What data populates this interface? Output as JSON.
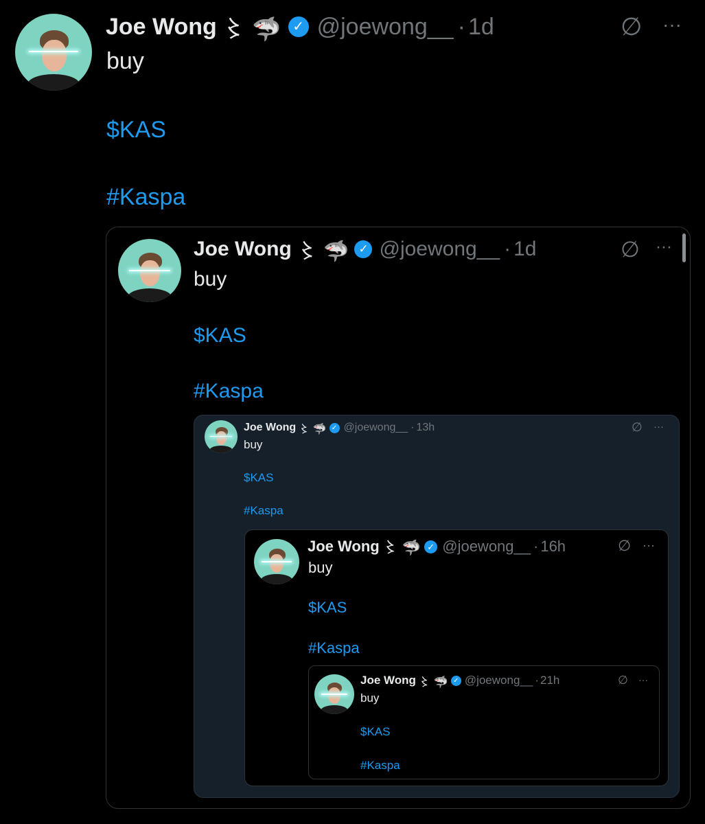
{
  "tweets": [
    {
      "name": "Joe Wong",
      "symbols": "〻 🦈",
      "handle": "@joewong__",
      "dot": "·",
      "time": "1d",
      "body": "buy",
      "ticker": "$KAS",
      "hashtag": "#Kaspa"
    },
    {
      "name": "Joe Wong",
      "symbols": "〻 🦈",
      "handle": "@joewong__",
      "dot": "·",
      "time": "1d",
      "body": "buy",
      "ticker": "$KAS",
      "hashtag": "#Kaspa"
    },
    {
      "name": "Joe Wong",
      "symbols": "〻 🦈",
      "handle": "@joewong__",
      "dot": "·",
      "time": "13h",
      "body": "buy",
      "ticker": "$KAS",
      "hashtag": "#Kaspa"
    },
    {
      "name": "Joe Wong",
      "symbols": "〻 🦈",
      "handle": "@joewong__",
      "dot": "·",
      "time": "16h",
      "body": "buy",
      "ticker": "$KAS",
      "hashtag": "#Kaspa"
    },
    {
      "name": "Joe Wong",
      "symbols": "〻 🦈",
      "handle": "@joewong__",
      "dot": "·",
      "time": "21h",
      "body": "buy",
      "ticker": "$KAS",
      "hashtag": "#Kaspa"
    }
  ],
  "icons": {
    "grok": "∅",
    "more": "···",
    "verified": "✓"
  },
  "colors": {
    "background": "#000000",
    "link": "#1d9bf0",
    "muted": "#71767b",
    "verified": "#1d9bf0",
    "avatar_bg": "#7fd3c1",
    "inner_card_bg": "#15202b"
  }
}
